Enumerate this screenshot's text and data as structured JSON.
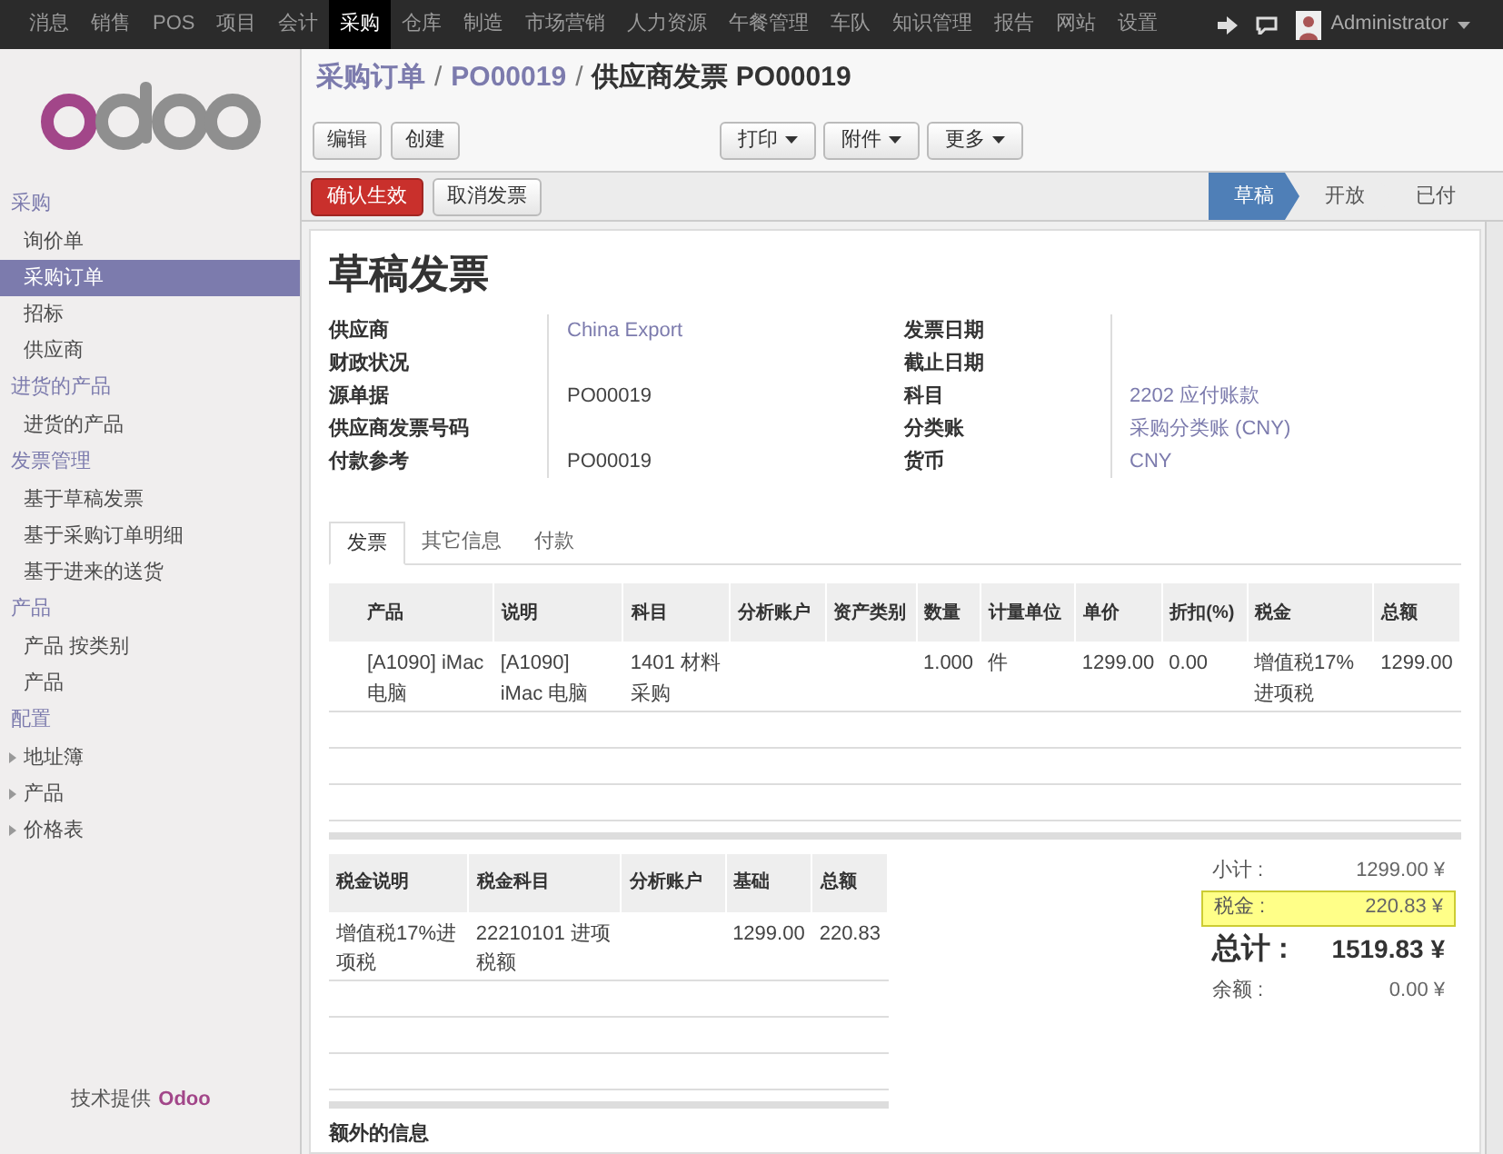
{
  "top_menu": [
    {
      "label": "消息",
      "selected": false
    },
    {
      "label": "销售",
      "selected": false
    },
    {
      "label": "POS",
      "selected": false
    },
    {
      "label": "项目",
      "selected": false
    },
    {
      "label": "会计",
      "selected": false
    },
    {
      "label": "采购",
      "selected": true
    },
    {
      "label": "仓库",
      "selected": false
    },
    {
      "label": "制造",
      "selected": false
    },
    {
      "label": "市场营销",
      "selected": false
    },
    {
      "label": "人力资源",
      "selected": false
    },
    {
      "label": "午餐管理",
      "selected": false
    },
    {
      "label": "车队",
      "selected": false
    },
    {
      "label": "知识管理",
      "selected": false
    },
    {
      "label": "报告",
      "selected": false
    },
    {
      "label": "网站",
      "selected": false
    },
    {
      "label": "设置",
      "selected": false
    }
  ],
  "user": {
    "name": "Administrator"
  },
  "sidebar": {
    "sections": [
      {
        "title": "采购",
        "items": [
          {
            "label": "询价单",
            "selected": false,
            "kind": "link"
          },
          {
            "label": "采购订单",
            "selected": true,
            "kind": "link"
          },
          {
            "label": "招标",
            "selected": false,
            "kind": "link"
          },
          {
            "label": "供应商",
            "selected": false,
            "kind": "link"
          }
        ]
      },
      {
        "title": "进货的产品",
        "items": [
          {
            "label": "进货的产品",
            "selected": false,
            "kind": "link"
          }
        ]
      },
      {
        "title": "发票管理",
        "items": [
          {
            "label": "基于草稿发票",
            "selected": false,
            "kind": "link"
          },
          {
            "label": "基于采购订单明细",
            "selected": false,
            "kind": "link"
          },
          {
            "label": "基于进来的送货",
            "selected": false,
            "kind": "link"
          }
        ]
      },
      {
        "title": "产品",
        "items": [
          {
            "label": "产品 按类别",
            "selected": false,
            "kind": "link"
          },
          {
            "label": "产品",
            "selected": false,
            "kind": "link"
          }
        ]
      },
      {
        "title": "配置",
        "items": [
          {
            "label": "地址簿",
            "selected": false,
            "kind": "expandable"
          },
          {
            "label": "产品",
            "selected": false,
            "kind": "expandable"
          },
          {
            "label": "价格表",
            "selected": false,
            "kind": "expandable"
          }
        ]
      }
    ],
    "powered_by": {
      "label": "技术提供",
      "brand": "Odoo"
    }
  },
  "breadcrumb": {
    "separator": "/",
    "items": [
      {
        "label": "采购订单",
        "kind": "link"
      },
      {
        "label": "PO00019",
        "kind": "link"
      },
      {
        "label": "供应商发票 PO00019",
        "kind": "current"
      }
    ]
  },
  "toolbar": {
    "buttons": [
      "编辑",
      "创建"
    ],
    "dropdowns": [
      "打印",
      "附件",
      "更多"
    ]
  },
  "actions": [
    {
      "label": "确认生效",
      "kind": "primary"
    },
    {
      "label": "取消发票",
      "kind": "default"
    }
  ],
  "status_steps": [
    {
      "label": "草稿",
      "selected": true
    },
    {
      "label": "开放",
      "selected": false
    },
    {
      "label": "已付",
      "selected": false
    }
  ],
  "form": {
    "title": "草稿发票",
    "left_fields": [
      {
        "label": "供应商",
        "value": "China Export",
        "kind": "link"
      },
      {
        "label": "财政状况"
      },
      {
        "label": "源单据",
        "value": "PO00019",
        "kind": "text"
      },
      {
        "label": "供应商发票号码"
      },
      {
        "label": "付款参考",
        "value": "PO00019",
        "kind": "text"
      }
    ],
    "right_fields": [
      {
        "label": "发票日期"
      },
      {
        "label": "截止日期"
      },
      {
        "label": "科目",
        "value": "2202 应付账款",
        "kind": "link"
      },
      {
        "label": "分类账",
        "value": "采购分类账 (CNY)",
        "kind": "link"
      },
      {
        "label": "货币",
        "value": "CNY",
        "kind": "link"
      }
    ]
  },
  "tabs": [
    {
      "label": "发票",
      "selected": true
    },
    {
      "label": "其它信息",
      "selected": false
    },
    {
      "label": "付款",
      "selected": false
    }
  ],
  "invoice_lines": {
    "columns": [
      "产品",
      "说明",
      "科目",
      "分析账户",
      "资产类别",
      "数量",
      "计量单位",
      "单价",
      "折扣(%)",
      "税金",
      "总额"
    ],
    "rows": [
      [
        "[A1090] iMac 电脑",
        "[A1090] iMac 电脑",
        "1401 材料采购",
        null,
        null,
        "1.000",
        "件",
        "1299.00",
        "0.00",
        "增值税17%进项税",
        "1299.00"
      ]
    ]
  },
  "tax_lines": {
    "columns": [
      "税金说明",
      "税金科目",
      "分析账户",
      "基础",
      "总额"
    ],
    "rows": [
      [
        "增值税17%进项税",
        "22210101 进项税额",
        null,
        "1299.00",
        "220.83"
      ]
    ]
  },
  "totals": [
    {
      "label": "小计 :",
      "value": "1299.00 ¥",
      "kind": "normal",
      "highlighted": false
    },
    {
      "label": "税金 :",
      "value": "220.83 ¥",
      "kind": "normal",
      "highlighted": true
    },
    {
      "label": "总计 :",
      "value": "1519.83 ¥",
      "kind": "grand",
      "highlighted": false
    },
    {
      "label": "余额 :",
      "value": "0.00 ¥",
      "kind": "normal",
      "highlighted": false
    }
  ],
  "extra_info": {
    "label": "额外的信息"
  }
}
